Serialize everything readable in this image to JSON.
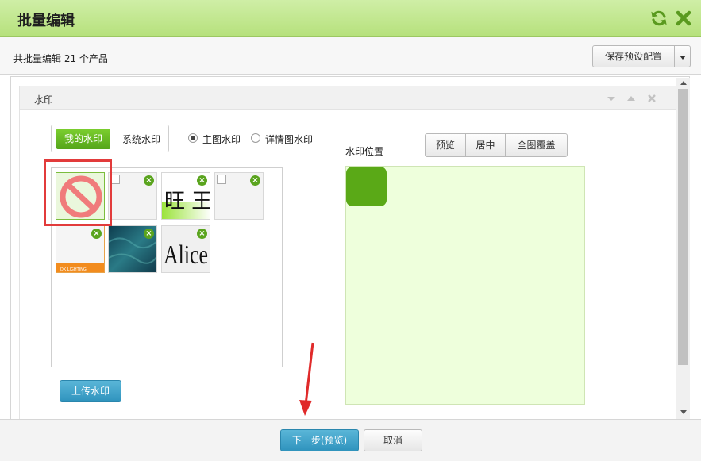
{
  "window": {
    "title": "批量编辑",
    "icons": [
      "refresh-icon",
      "close-icon"
    ]
  },
  "subbar": {
    "count_text": "共批量编辑 21 个产品",
    "save_button": "保存预设配置"
  },
  "panel": {
    "title": "水印",
    "header_icons": [
      "chevron-down-icon",
      "chevron-up-icon",
      "close-icon"
    ]
  },
  "tabs": {
    "mine": "我的水印",
    "system": "系统水印"
  },
  "radios": {
    "main": "主图水印",
    "detail": "详情图水印",
    "selected": "主图水印"
  },
  "watermarks": {
    "items": [
      {
        "kind": "none",
        "selected": true
      },
      {
        "kind": "broken-image"
      },
      {
        "kind": "text-image",
        "text": "旺 王"
      },
      {
        "kind": "broken-image"
      },
      {
        "kind": "banner-image",
        "text": "DK LIGHTING"
      },
      {
        "kind": "photo-image"
      },
      {
        "kind": "text-image",
        "text": "Alice"
      }
    ],
    "upload_button": "上传水印"
  },
  "position": {
    "label": "水印位置",
    "preview_button": "预览",
    "center_button": "居中",
    "cover_button": "全图覆盖",
    "accent_color": "#5aa917",
    "area_color": "#eeffdc"
  },
  "footer": {
    "next_button": "下一步(预览)",
    "cancel_button": "取消"
  },
  "colors": {
    "titlebar": "#b6e17c",
    "primary_button": "#2f93bd",
    "selection_frame": "#e23b3b"
  }
}
